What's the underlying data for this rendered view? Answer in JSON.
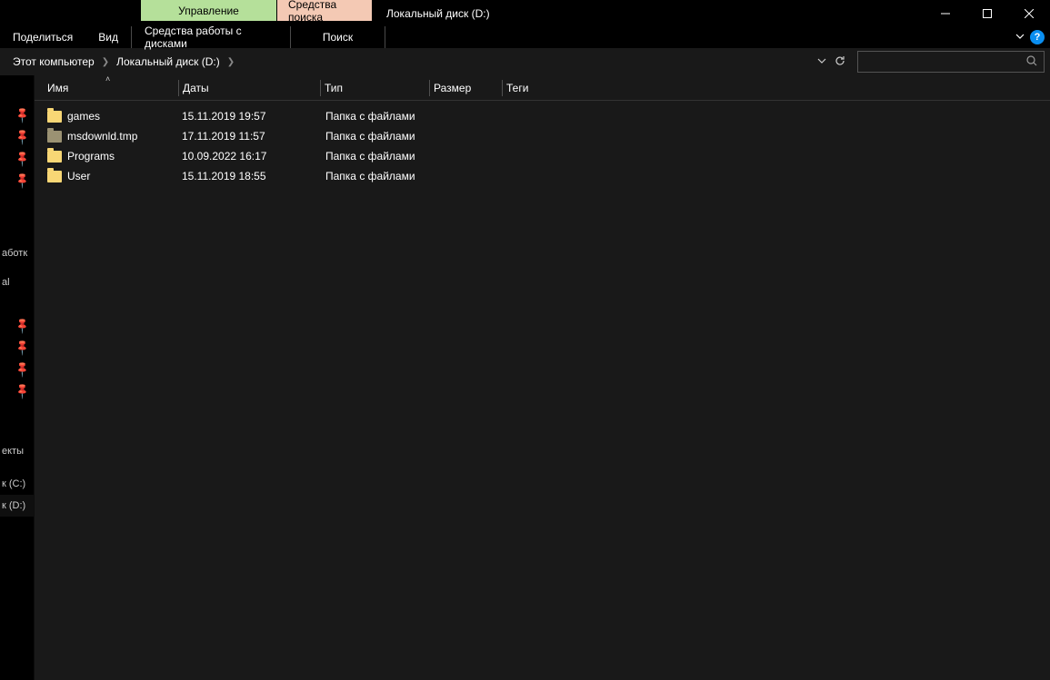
{
  "titlebar": {
    "context_tab_green": "Управление",
    "context_tab_pink": "Средства поиска",
    "title": "Локальный диск (D:)"
  },
  "ribbon": {
    "share": "Поделиться",
    "view": "Вид",
    "drive_tools": "Средства работы с дисками",
    "search": "Поиск"
  },
  "breadcrumbs": {
    "root": "Этот компьютер",
    "current": "Локальный диск (D:)"
  },
  "columns": {
    "name": "Имя",
    "date": "Даты",
    "type": "Тип",
    "size": "Размер",
    "tags": "Теги"
  },
  "items": [
    {
      "name": "games",
      "date": "15.11.2019 19:57",
      "type": "Папка с файлами",
      "dim": false
    },
    {
      "name": "msdownld.tmp",
      "date": "17.11.2019 11:57",
      "type": "Папка с файлами",
      "dim": true
    },
    {
      "name": "Programs",
      "date": "10.09.2022 16:17",
      "type": "Папка с файлами",
      "dim": false
    },
    {
      "name": "User",
      "date": "15.11.2019 18:55",
      "type": "Папка с файлами",
      "dim": false
    }
  ],
  "nav": {
    "items": [
      "аботк",
      "al",
      "",
      "",
      "",
      "екты",
      "",
      "к (C:)",
      "к (D:)"
    ],
    "selected_index": 8
  },
  "help_label": "?"
}
